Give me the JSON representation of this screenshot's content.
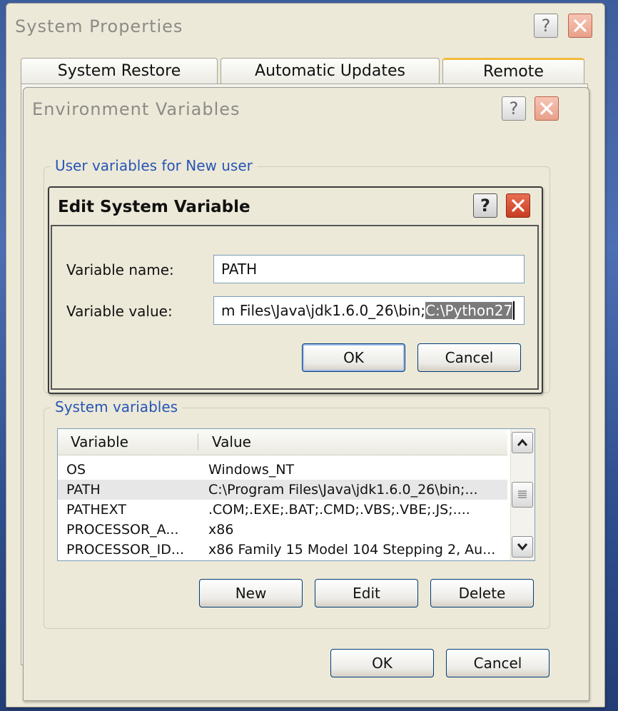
{
  "system_properties": {
    "title": "System Properties",
    "tabs": [
      "System Restore",
      "Automatic Updates",
      "Remote"
    ]
  },
  "environment_variables": {
    "title": "Environment Variables",
    "user_group_label": "User variables for New user",
    "system_group_label": "System variables",
    "columns": [
      "Variable",
      "Value"
    ],
    "rows": [
      {
        "variable": "OS",
        "value": "Windows_NT"
      },
      {
        "variable": "PATH",
        "value": "C:\\Program Files\\Java\\jdk1.6.0_26\\bin;..."
      },
      {
        "variable": "PATHEXT",
        "value": ".COM;.EXE;.BAT;.CMD;.VBS;.VBE;.JS;...."
      },
      {
        "variable": "PROCESSOR_A...",
        "value": "x86"
      },
      {
        "variable": "PROCESSOR_ID...",
        "value": "x86 Family 15 Model 104 Stepping 2, Au..."
      }
    ],
    "selected_row": "PATH",
    "buttons": {
      "new": "New",
      "edit": "Edit",
      "delete": "Delete",
      "ok": "OK",
      "cancel": "Cancel"
    }
  },
  "edit_dialog": {
    "title": "Edit System Variable",
    "name_label": "Variable name:",
    "value_label": "Variable value:",
    "name_value": "PATH",
    "value_prefix": "m Files\\Java\\jdk1.6.0_26\\bin;",
    "value_selected": "C:\\Python27",
    "ok": "OK",
    "cancel": "Cancel"
  },
  "icons": {
    "help": "help-icon",
    "close": "close-icon",
    "scroll_up": "arrow-up-icon",
    "scroll_down": "arrow-down-icon",
    "scroll_thumb": "scroll-thumb-grip-icon"
  },
  "colors": {
    "window_bg": "#ece9d8",
    "group_label": "#2754b6",
    "close_red": "#d9492b",
    "selection_gray": "#7a7a7a"
  }
}
